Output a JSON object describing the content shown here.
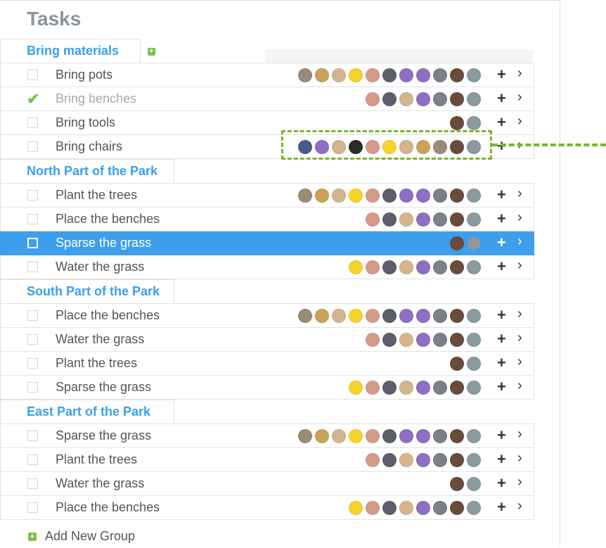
{
  "page": {
    "title": "Tasks"
  },
  "colors": {
    "accent": "#3aa0ea",
    "selected_row": "#3d9fec",
    "check": "#7cc243",
    "callout": "#7cb52a"
  },
  "avatar_palette": [
    "#9a8a7a",
    "#c9a35a",
    "#d4b48c",
    "#f6d32b",
    "#5b5f6b",
    "#d79a8a",
    "#8f6fc2",
    "#7a7f8c",
    "#6a4b3c",
    "#8a9aa2",
    "#4a5a8a",
    "#2b2b2b"
  ],
  "groups": [
    {
      "name": "Bring materials",
      "show_add": true,
      "tasks": [
        {
          "label": "Bring pots",
          "checked": false,
          "done": false,
          "selected": false,
          "avatars": [
            "a0",
            "a1",
            "a2",
            "a3",
            "a5",
            "a4",
            "a6",
            "a6",
            "a7",
            "a8",
            "a9"
          ]
        },
        {
          "label": "Bring benches",
          "checked": true,
          "done": true,
          "selected": false,
          "avatars": [
            "a5",
            "a4",
            "a2",
            "a6",
            "a7",
            "a8",
            "a9"
          ]
        },
        {
          "label": "Bring tools",
          "checked": false,
          "done": false,
          "selected": false,
          "avatars": [
            "a8",
            "a9"
          ]
        },
        {
          "label": "Bring chairs",
          "checked": false,
          "done": false,
          "selected": false,
          "avatars": [
            "a10",
            "a6",
            "a2",
            "a11",
            "a5",
            "a3",
            "a2",
            "a1",
            "a0",
            "a8",
            "a9"
          ]
        }
      ]
    },
    {
      "name": "North Part of the Park",
      "show_add": false,
      "tasks": [
        {
          "label": "Plant the trees",
          "checked": false,
          "done": false,
          "selected": false,
          "avatars": [
            "a0",
            "a1",
            "a2",
            "a3",
            "a5",
            "a4",
            "a6",
            "a6",
            "a7",
            "a8",
            "a9"
          ]
        },
        {
          "label": "Place the benches",
          "checked": false,
          "done": false,
          "selected": false,
          "avatars": [
            "a5",
            "a4",
            "a2",
            "a6",
            "a7",
            "a8",
            "a9"
          ]
        },
        {
          "label": "Sparse the grass",
          "checked": false,
          "done": false,
          "selected": true,
          "avatars": [
            "a8",
            "a9"
          ]
        },
        {
          "label": "Water the grass",
          "checked": false,
          "done": false,
          "selected": false,
          "avatars": [
            "a3",
            "a5",
            "a4",
            "a2",
            "a6",
            "a7",
            "a8",
            "a9"
          ]
        }
      ]
    },
    {
      "name": "South Part of the Park",
      "show_add": false,
      "tasks": [
        {
          "label": "Place the benches",
          "checked": false,
          "done": false,
          "selected": false,
          "avatars": [
            "a0",
            "a1",
            "a2",
            "a3",
            "a5",
            "a4",
            "a6",
            "a6",
            "a7",
            "a8",
            "a9"
          ]
        },
        {
          "label": "Water the grass",
          "checked": false,
          "done": false,
          "selected": false,
          "avatars": [
            "a5",
            "a4",
            "a2",
            "a6",
            "a7",
            "a8",
            "a9"
          ]
        },
        {
          "label": "Plant the trees",
          "checked": false,
          "done": false,
          "selected": false,
          "avatars": [
            "a8",
            "a9"
          ]
        },
        {
          "label": "Sparse the grass",
          "checked": false,
          "done": false,
          "selected": false,
          "avatars": [
            "a3",
            "a5",
            "a4",
            "a2",
            "a6",
            "a7",
            "a8",
            "a9"
          ]
        }
      ]
    },
    {
      "name": "East Part of the Park",
      "show_add": false,
      "tasks": [
        {
          "label": "Sparse the grass",
          "checked": false,
          "done": false,
          "selected": false,
          "avatars": [
            "a0",
            "a1",
            "a2",
            "a3",
            "a5",
            "a4",
            "a6",
            "a6",
            "a7",
            "a8",
            "a9"
          ]
        },
        {
          "label": "Plant the trees",
          "checked": false,
          "done": false,
          "selected": false,
          "avatars": [
            "a5",
            "a4",
            "a2",
            "a6",
            "a7",
            "a8",
            "a9"
          ]
        },
        {
          "label": "Water the grass",
          "checked": false,
          "done": false,
          "selected": false,
          "avatars": [
            "a8",
            "a9"
          ]
        },
        {
          "label": "Place the benches",
          "checked": false,
          "done": false,
          "selected": false,
          "avatars": [
            "a3",
            "a5",
            "a4",
            "a2",
            "a6",
            "a7",
            "a8",
            "a9"
          ]
        }
      ]
    }
  ],
  "row_actions": {
    "add_glyph": "+",
    "open_glyph": "›",
    "checked_glyph": "✔"
  },
  "footer": {
    "add_group_label": "Add New Group",
    "add_icon_glyph": "+"
  }
}
